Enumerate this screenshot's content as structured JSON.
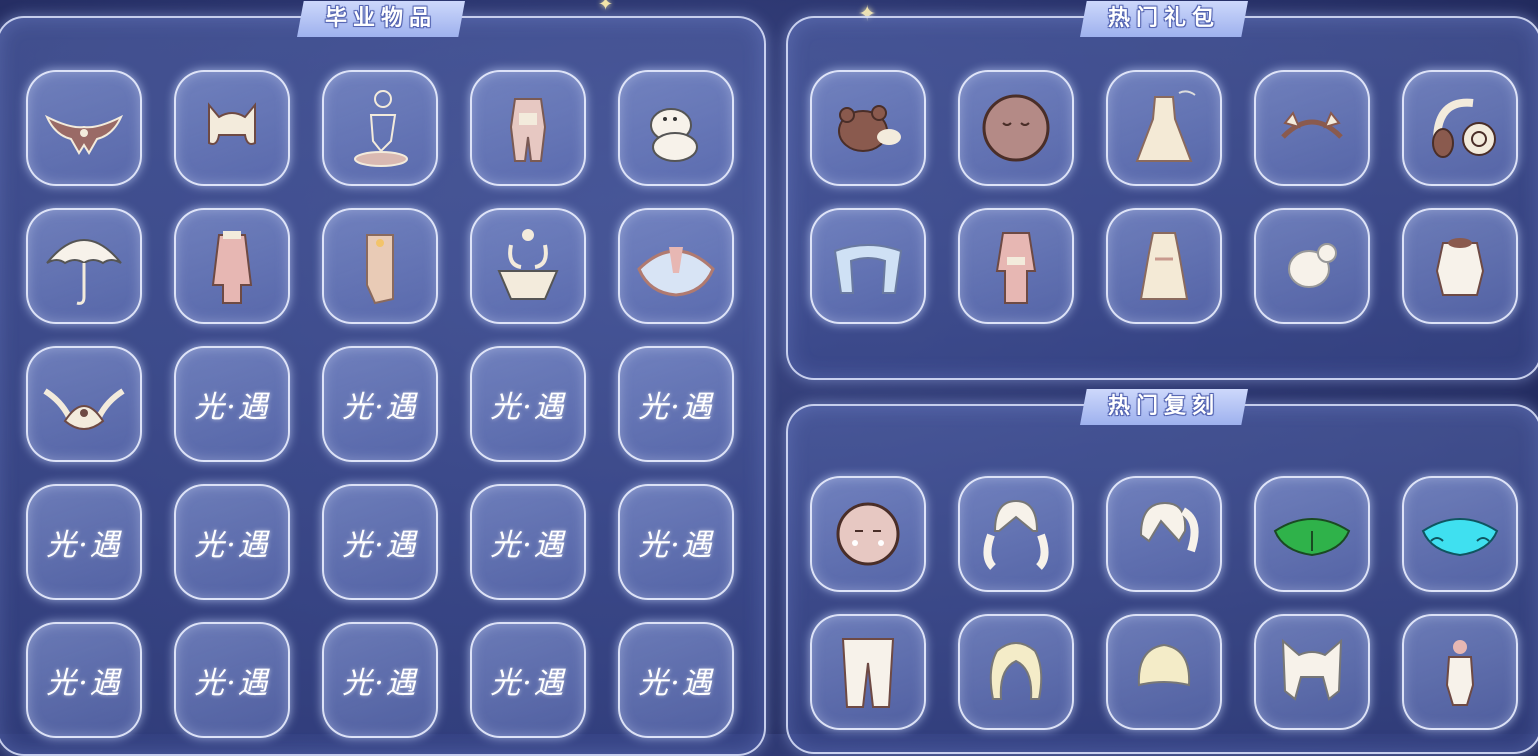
{
  "panels": {
    "graduation": {
      "title": "毕业物品",
      "items": [
        {
          "icon": "wing-cape-icon"
        },
        {
          "icon": "hair-ears-icon"
        },
        {
          "icon": "figure-emote-icon"
        },
        {
          "icon": "outfit-icon"
        },
        {
          "icon": "moomin-plush-icon"
        },
        {
          "icon": "umbrella-icon"
        },
        {
          "icon": "coat-icon"
        },
        {
          "icon": "scarf-icon"
        },
        {
          "icon": "horned-mask-icon"
        },
        {
          "icon": "cape-icon"
        },
        {
          "icon": "winged-mask-icon"
        },
        {
          "icon": "placeholder-logo-icon"
        },
        {
          "icon": "placeholder-logo-icon"
        },
        {
          "icon": "placeholder-logo-icon"
        },
        {
          "icon": "placeholder-logo-icon"
        },
        {
          "icon": "placeholder-logo-icon"
        },
        {
          "icon": "placeholder-logo-icon"
        },
        {
          "icon": "placeholder-logo-icon"
        },
        {
          "icon": "placeholder-logo-icon"
        },
        {
          "icon": "placeholder-logo-icon"
        },
        {
          "icon": "placeholder-logo-icon"
        },
        {
          "icon": "placeholder-logo-icon"
        },
        {
          "icon": "placeholder-logo-icon"
        },
        {
          "icon": "placeholder-logo-icon"
        },
        {
          "icon": "placeholder-logo-icon"
        }
      ]
    },
    "hot_gifts": {
      "title": "热门礼包",
      "items": [
        {
          "icon": "bear-hat-icon"
        },
        {
          "icon": "mask-face-icon"
        },
        {
          "icon": "dress-icon"
        },
        {
          "icon": "headband-icon"
        },
        {
          "icon": "headphones-icon"
        },
        {
          "icon": "scarf-blue-icon"
        },
        {
          "icon": "pink-outfit-icon"
        },
        {
          "icon": "robe-icon"
        },
        {
          "icon": "hair-bun-icon"
        },
        {
          "icon": "cream-top-icon"
        }
      ]
    },
    "hot_reruns": {
      "title": "热门复刻",
      "items": [
        {
          "icon": "blush-mask-icon"
        },
        {
          "icon": "twin-tail-hair-icon"
        },
        {
          "icon": "ponytail-hair-icon"
        },
        {
          "icon": "green-cape-icon"
        },
        {
          "icon": "cyan-cape-icon"
        },
        {
          "icon": "pants-icon"
        },
        {
          "icon": "wavy-hair-icon"
        },
        {
          "icon": "short-hair-icon"
        },
        {
          "icon": "cat-ear-hair-icon"
        },
        {
          "icon": "small-outfit-icon"
        }
      ]
    }
  },
  "placeholder_text": "光·遇",
  "colors": {
    "accent": "#9eb1ee",
    "item_cream": "#f3ebdc",
    "item_brown": "#8a5a4e",
    "item_pink": "#e7b7b3",
    "item_green": "#2fb24a",
    "item_cyan": "#3fe0f0"
  }
}
